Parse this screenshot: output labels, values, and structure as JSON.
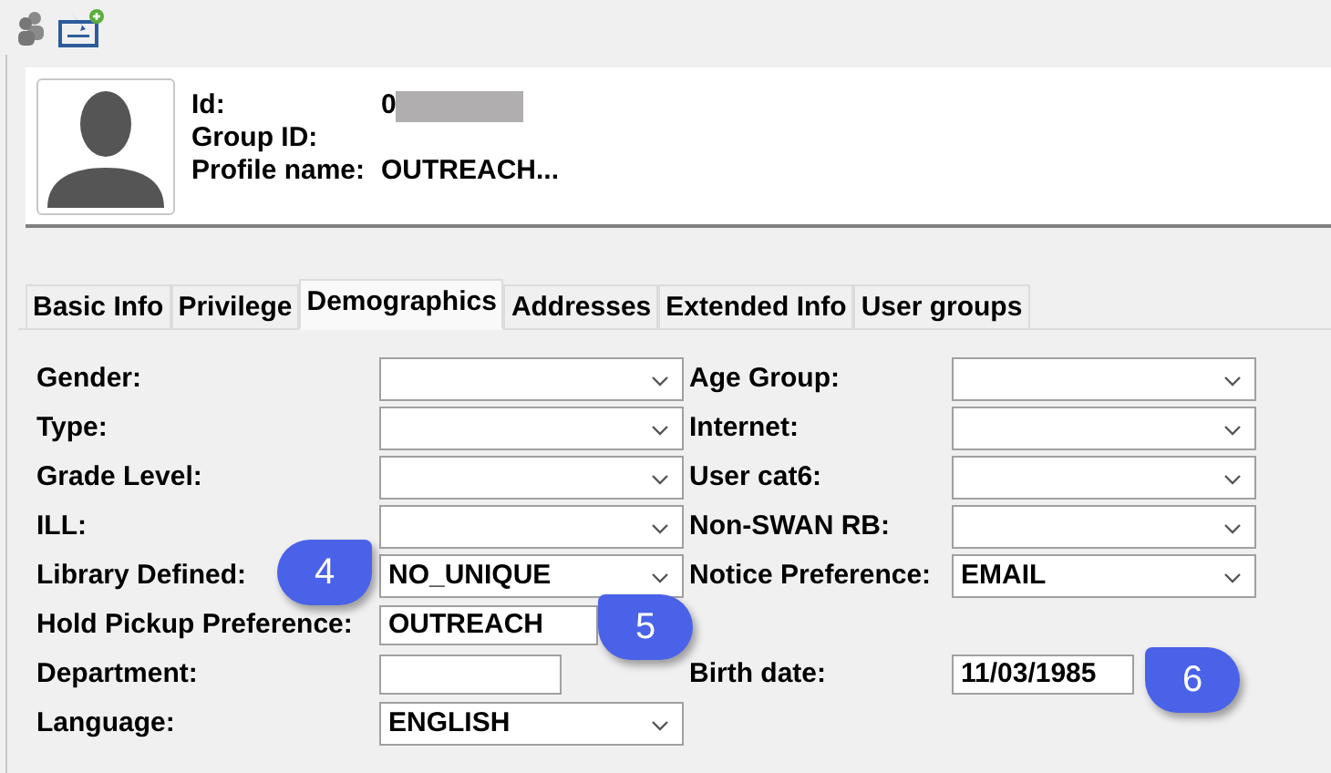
{
  "profile": {
    "id_label": "Id:",
    "id_value": "0",
    "group_label": "Group ID:",
    "name_label": "Profile name:",
    "name_value": "OUTREACH..."
  },
  "tabs": [
    {
      "label": "Basic Info",
      "selected": false
    },
    {
      "label": "Privilege",
      "selected": false
    },
    {
      "label": "Demographics",
      "selected": true
    },
    {
      "label": "Addresses",
      "selected": false
    },
    {
      "label": "Extended Info",
      "selected": false
    },
    {
      "label": "User groups",
      "selected": false
    }
  ],
  "rows": [
    {
      "left": {
        "label": "Gender:",
        "kind": "select"
      },
      "right": {
        "label": "Age Group:",
        "kind": "select"
      }
    },
    {
      "left": {
        "label": "Type:",
        "kind": "select"
      },
      "right": {
        "label": "Internet:",
        "kind": "select"
      }
    },
    {
      "left": {
        "label": "Grade Level:",
        "kind": "select"
      },
      "right": {
        "label": "User cat6:",
        "kind": "select"
      }
    },
    {
      "left": {
        "label": "ILL:",
        "kind": "select"
      },
      "right": {
        "label": "Non-SWAN RB:",
        "kind": "select"
      }
    },
    {
      "left": {
        "label": "Library Defined:",
        "kind": "select",
        "value": "NO_UNIQUE"
      },
      "right": {
        "label": "Notice Preference:",
        "kind": "select",
        "value": "EMAIL"
      }
    },
    {
      "left": {
        "label": "Hold Pickup Preference:",
        "kind": "text",
        "value": "OUTREACH"
      }
    },
    {
      "left": {
        "label": "Department:",
        "kind": "text"
      },
      "right": {
        "label": "Birth date:",
        "kind": "text",
        "value": "11/03/1985"
      }
    },
    {
      "left": {
        "label": "Language:",
        "kind": "select",
        "value": "ENGLISH"
      }
    }
  ],
  "callouts": [
    {
      "number": "4"
    },
    {
      "number": "5"
    },
    {
      "number": "6"
    }
  ]
}
